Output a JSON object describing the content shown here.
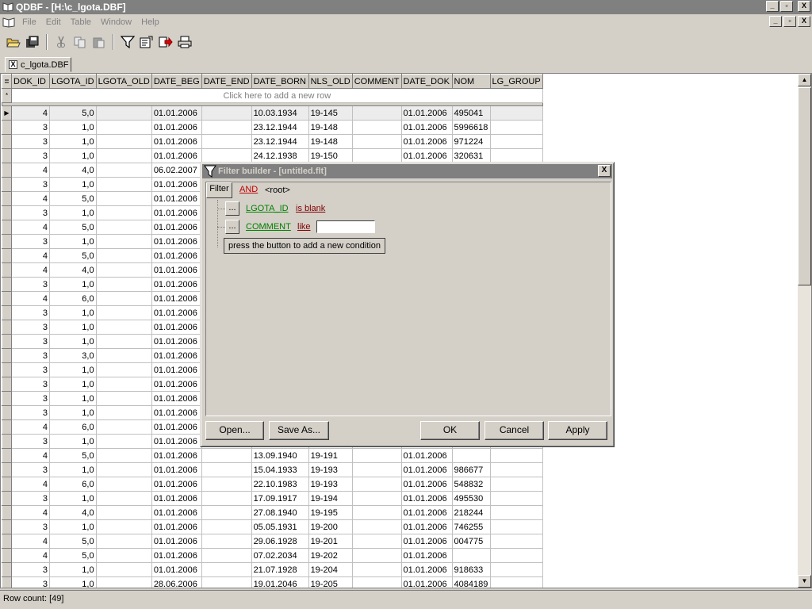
{
  "window": {
    "title": "QDBF - [H:\\c_lgota.DBF]",
    "min": "_",
    "max": "▫",
    "close": "X"
  },
  "menu": {
    "items": [
      "File",
      "Edit",
      "Table",
      "Window",
      "Help"
    ]
  },
  "doc_tab": {
    "label": "c_lgota.DBF",
    "close": "X"
  },
  "grid": {
    "columns": [
      "DOK_ID",
      "LGOTA_ID",
      "LGOTA_OLD",
      "DATE_BEG",
      "DATE_END",
      "DATE_BORN",
      "NLS_OLD",
      "COMMENT",
      "DATE_DOK",
      "NOM",
      "LG_GROUP"
    ],
    "new_row_text": "Click here to add a new row",
    "rows": [
      [
        "4",
        "5,0",
        "",
        "01.01.2006",
        "",
        "10.03.1934",
        "19-145",
        "",
        "01.01.2006",
        "495041",
        ""
      ],
      [
        "3",
        "1,0",
        "",
        "01.01.2006",
        "",
        "23.12.1944",
        "19-148",
        "",
        "01.01.2006",
        "5996618",
        ""
      ],
      [
        "3",
        "1,0",
        "",
        "01.01.2006",
        "",
        "23.12.1944",
        "19-148",
        "",
        "01.01.2006",
        "971224",
        ""
      ],
      [
        "3",
        "1,0",
        "",
        "01.01.2006",
        "",
        "24.12.1938",
        "19-150",
        "",
        "01.01.2006",
        "320631",
        ""
      ],
      [
        "4",
        "4,0",
        "",
        "06.02.2007",
        "",
        "",
        "",
        "",
        "",
        "",
        ""
      ],
      [
        "3",
        "1,0",
        "",
        "01.01.2006",
        "",
        "",
        "",
        "",
        "",
        "",
        ""
      ],
      [
        "4",
        "5,0",
        "",
        "01.01.2006",
        "",
        "",
        "",
        "",
        "",
        "",
        ""
      ],
      [
        "3",
        "1,0",
        "",
        "01.01.2006",
        "",
        "",
        "",
        "",
        "",
        "",
        ""
      ],
      [
        "4",
        "5,0",
        "",
        "01.01.2006",
        "",
        "",
        "",
        "",
        "",
        "",
        ""
      ],
      [
        "3",
        "1,0",
        "",
        "01.01.2006",
        "",
        "",
        "",
        "",
        "",
        "",
        ""
      ],
      [
        "4",
        "5,0",
        "",
        "01.01.2006",
        "",
        "",
        "",
        "",
        "",
        "",
        ""
      ],
      [
        "4",
        "4,0",
        "",
        "01.01.2006",
        "",
        "",
        "",
        "",
        "",
        "",
        ""
      ],
      [
        "3",
        "1,0",
        "",
        "01.01.2006",
        "",
        "",
        "",
        "",
        "",
        "",
        ""
      ],
      [
        "4",
        "6,0",
        "",
        "01.01.2006",
        "",
        "",
        "",
        "",
        "",
        "",
        ""
      ],
      [
        "3",
        "1,0",
        "",
        "01.01.2006",
        "",
        "",
        "",
        "",
        "",
        "",
        ""
      ],
      [
        "3",
        "1,0",
        "",
        "01.01.2006",
        "",
        "",
        "",
        "",
        "",
        "",
        ""
      ],
      [
        "3",
        "1,0",
        "",
        "01.01.2006",
        "",
        "",
        "",
        "",
        "",
        "",
        ""
      ],
      [
        "3",
        "3,0",
        "",
        "01.01.2006",
        "",
        "",
        "",
        "",
        "",
        "",
        ""
      ],
      [
        "3",
        "1,0",
        "",
        "01.01.2006",
        "",
        "",
        "",
        "",
        "",
        "",
        ""
      ],
      [
        "3",
        "1,0",
        "",
        "01.01.2006",
        "",
        "",
        "",
        "",
        "",
        "",
        ""
      ],
      [
        "3",
        "1,0",
        "",
        "01.01.2006",
        "",
        "",
        "",
        "",
        "",
        "",
        ""
      ],
      [
        "3",
        "1,0",
        "",
        "01.01.2006",
        "",
        "",
        "",
        "",
        "",
        "",
        ""
      ],
      [
        "4",
        "6,0",
        "",
        "01.01.2006",
        "",
        "",
        "",
        "",
        "",
        "",
        ""
      ],
      [
        "3",
        "1,0",
        "",
        "01.01.2006",
        "",
        "",
        "",
        "",
        "",
        "",
        ""
      ],
      [
        "4",
        "5,0",
        "",
        "01.01.2006",
        "",
        "13.09.1940",
        "19-191",
        "",
        "01.01.2006",
        "",
        ""
      ],
      [
        "3",
        "1,0",
        "",
        "01.01.2006",
        "",
        "15.04.1933",
        "19-193",
        "",
        "01.01.2006",
        "986677",
        ""
      ],
      [
        "4",
        "6,0",
        "",
        "01.01.2006",
        "",
        "22.10.1983",
        "19-193",
        "",
        "01.01.2006",
        "548832",
        ""
      ],
      [
        "3",
        "1,0",
        "",
        "01.01.2006",
        "",
        "17.09.1917",
        "19-194",
        "",
        "01.01.2006",
        "495530",
        ""
      ],
      [
        "4",
        "4,0",
        "",
        "01.01.2006",
        "",
        "27.08.1940",
        "19-195",
        "",
        "01.01.2006",
        "218244",
        ""
      ],
      [
        "3",
        "1,0",
        "",
        "01.01.2006",
        "",
        "05.05.1931",
        "19-200",
        "",
        "01.01.2006",
        "746255",
        ""
      ],
      [
        "4",
        "5,0",
        "",
        "01.01.2006",
        "",
        "29.06.1928",
        "19-201",
        "",
        "01.01.2006",
        "004775",
        ""
      ],
      [
        "4",
        "5,0",
        "",
        "01.01.2006",
        "",
        "07.02.2034",
        "19-202",
        "",
        "01.01.2006",
        "",
        ""
      ],
      [
        "3",
        "1,0",
        "",
        "01.01.2006",
        "",
        "21.07.1928",
        "19-204",
        "",
        "01.01.2006",
        "918633",
        ""
      ],
      [
        "3",
        "1,0",
        "",
        "28.06.2006",
        "",
        "19.01.2046",
        "19-205",
        "",
        "01.01.2006",
        "4084189",
        ""
      ]
    ]
  },
  "status": {
    "text": "Row count: [49]"
  },
  "filter_dialog": {
    "title": "Filter builder - [untitled.flt]",
    "close": "X",
    "filter_btn": "Filter",
    "operator": "AND",
    "root": "<root>",
    "conditions": [
      {
        "btn": "...",
        "field": "LGOTA_ID",
        "op": "is blank"
      },
      {
        "btn": "...",
        "field": "COMMENT",
        "op": "like",
        "value": ""
      }
    ],
    "hint": "press the button to add a new condition",
    "buttons": {
      "open": "Open...",
      "save_as": "Save As...",
      "ok": "OK",
      "cancel": "Cancel",
      "apply": "Apply"
    }
  }
}
